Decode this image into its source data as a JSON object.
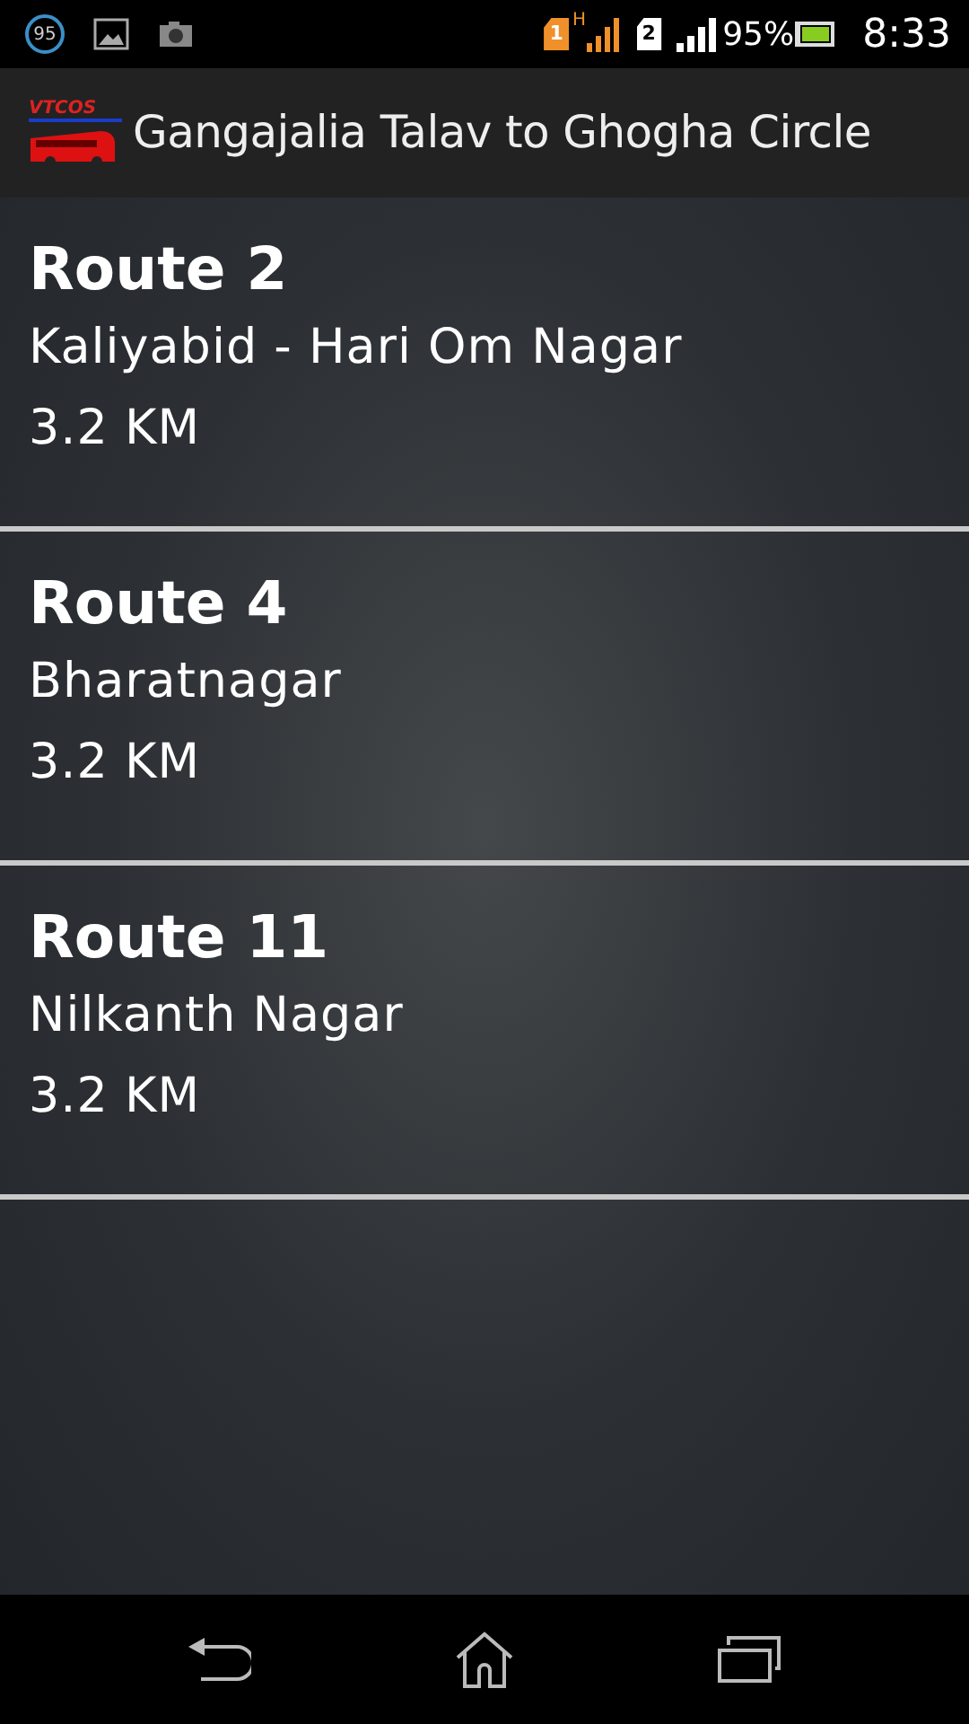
{
  "status_bar": {
    "notification_badge": "95",
    "sim1": "1",
    "network_type": "H",
    "sim2": "2",
    "battery_percent": "95%",
    "time": "8:33"
  },
  "action_bar": {
    "logo_text": "VTCOS",
    "title": "Gangajalia Talav to Ghogha Circle"
  },
  "routes": [
    {
      "name": "Route 2",
      "stops": "Kaliyabid - Hari Om Nagar",
      "distance": "3.2 KM"
    },
    {
      "name": "Route 4",
      "stops": "Bharatnagar",
      "distance": "3.2 KM"
    },
    {
      "name": "Route 11",
      "stops": "Nilkanth Nagar",
      "distance": "3.2 KM"
    }
  ]
}
